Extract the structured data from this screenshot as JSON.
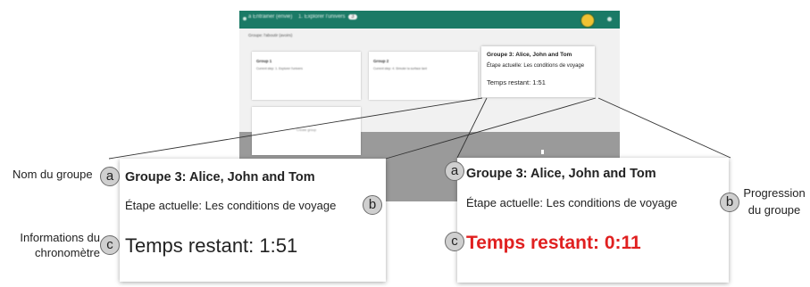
{
  "screenshot": {
    "crumb_1": "a Entrainer (envie)",
    "crumb_2": "1. Explorer l'univers",
    "crumb_pill": "3",
    "caption": "Groupe: l'aboutir (avoirs)",
    "mini_cards": [
      {
        "title": "Group 1",
        "subtitle": "Current step: 1. Explorer l'univers"
      },
      {
        "title": "Group 2",
        "subtitle": "Current step: 4. Simuler la surface tant"
      },
      {
        "title": "",
        "subtitle": "Create group"
      }
    ]
  },
  "small_card": {
    "title": "Groupe 3: Alice, John and Tom",
    "step": "Étape actuelle: Les conditions de voyage",
    "timer": "Temps restant: 1:51"
  },
  "card_left": {
    "title": "Groupe 3: Alice, John and Tom",
    "step": "Étape actuelle: Les conditions de voyage",
    "timer": "Temps restant: 1:51"
  },
  "card_right": {
    "title": "Groupe 3: Alice, John and Tom",
    "step": "Étape actuelle: Les conditions de voyage",
    "timer": "Temps restant: 0:11"
  },
  "markers": {
    "a": "a",
    "b": "b",
    "c": "c"
  },
  "labels": {
    "group_name": "Nom du groupe",
    "timer_info_line1": "Informations du",
    "timer_info_line2": "chronomètre",
    "progress_line1": "Progression",
    "progress_line2": "du groupe"
  },
  "colors": {
    "topbar": "#1b7a66",
    "timer_alert": "#e02020",
    "marker_fill": "#cfcfcf"
  }
}
